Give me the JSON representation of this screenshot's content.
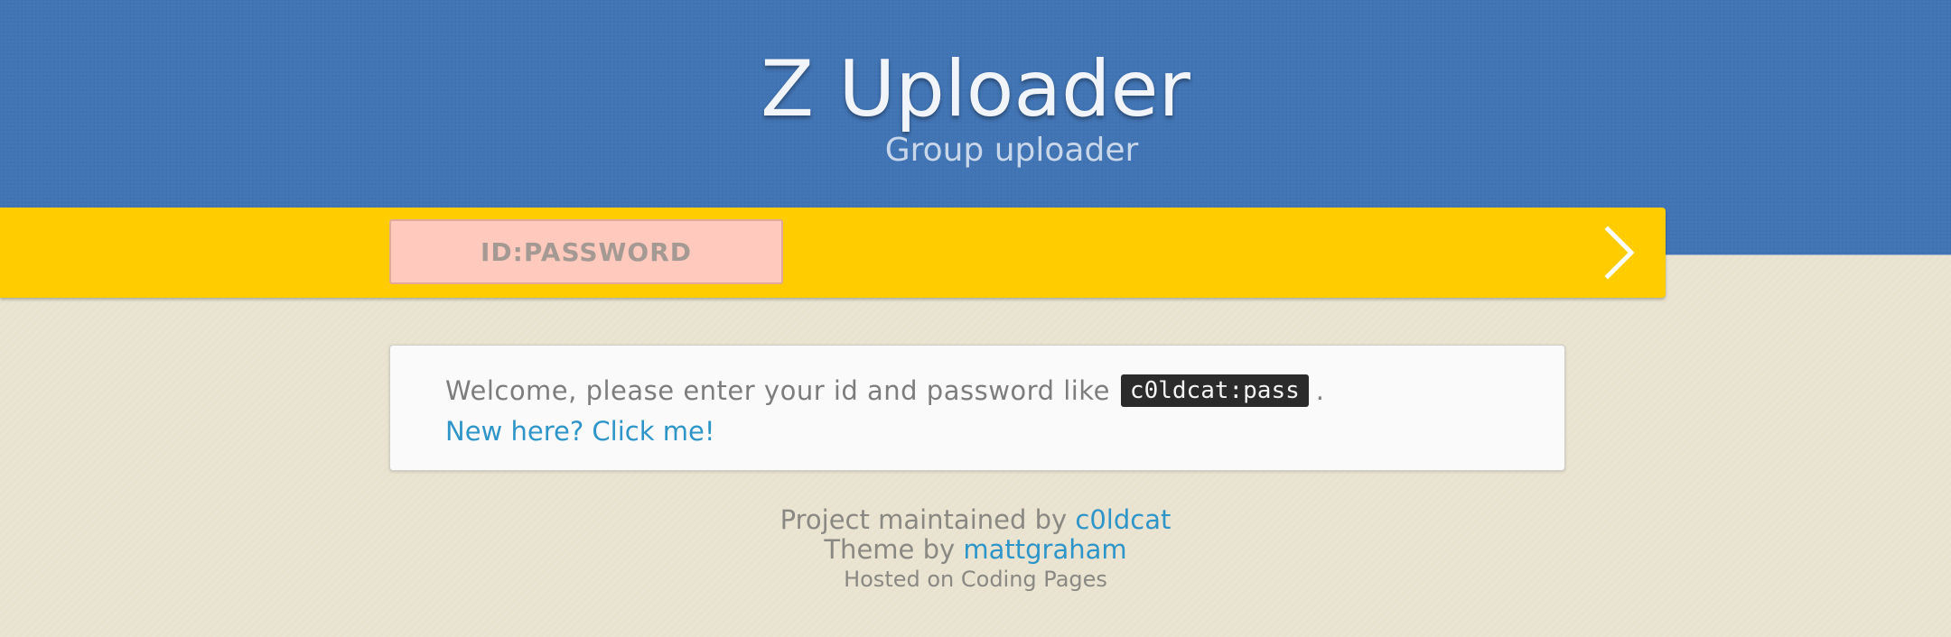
{
  "header": {
    "title": "Z Uploader",
    "subtitle": "Group uploader"
  },
  "login": {
    "placeholder": "ID:PASSWORD",
    "value": "",
    "submit_icon": "chevron-right-icon"
  },
  "notice": {
    "welcome_text": "Welcome, please enter your id and password like",
    "example_code": "c0ldcat:pass",
    "trailing_period": ".",
    "signup_link": "New here? Click me!"
  },
  "footer": {
    "maintained_text": "Project maintained by",
    "maintainer_link": "c0ldcat",
    "theme_text": "Theme by",
    "theme_author_link": "mattgraham",
    "hosted_text": "Hosted on Coding Pages"
  },
  "colors": {
    "header_blue": "#4174b4",
    "accent_yellow": "#ffcc00",
    "input_pink": "#ffc9bd",
    "link_blue": "#2e95c9",
    "page_beige": "#e8e2cf"
  }
}
